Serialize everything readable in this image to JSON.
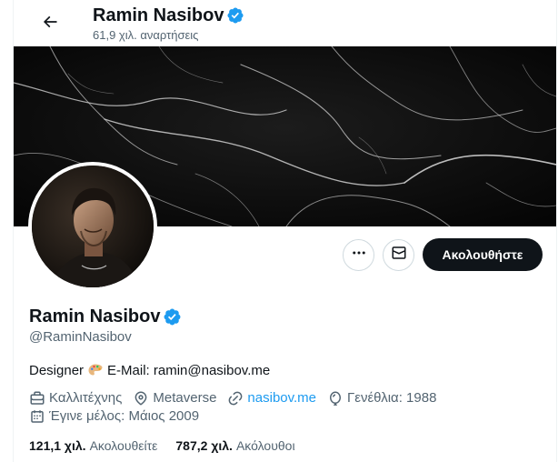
{
  "header": {
    "name": "Ramin Nasibov",
    "posts_count": "61,9 χιλ. αναρτήσεις"
  },
  "actions": {
    "follow_label": "Ακολουθήστε"
  },
  "profile": {
    "display_name": "Ramin Nasibov",
    "handle": "@RaminNasibov",
    "bio_prefix": "Designer",
    "bio_suffix": "E-Mail: ramin@nasibov.me",
    "category": "Καλλιτέχνης",
    "location": "Metaverse",
    "website": "nasibov.me",
    "birthday": "Γενέθλια: 1988",
    "joined": "Έγινε μέλος: Μάιος 2009"
  },
  "stats": {
    "following_count": "121,1 χιλ.",
    "following_label": "Ακολουθείτε",
    "followers_count": "787,2 χιλ.",
    "followers_label": "Ακόλουθοι"
  },
  "colors": {
    "accent": "#1d9bf0",
    "text": "#0f1419",
    "secondary": "#536471",
    "follow_button": "#0f1419"
  }
}
